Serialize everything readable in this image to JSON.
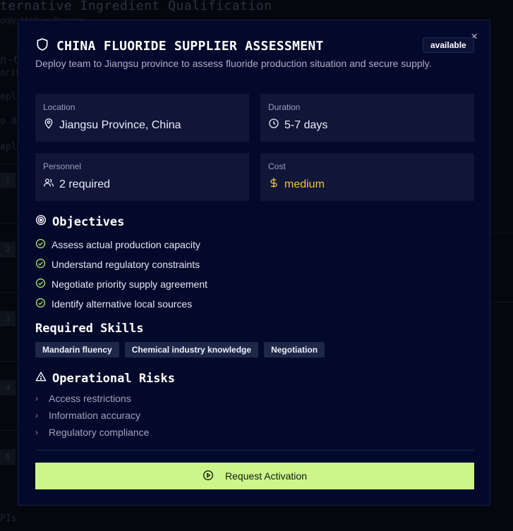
{
  "background": {
    "title": "ternative Ingredient Qualification",
    "subtitle": "ority: Medium Duration",
    "fragments": [
      "n-C",
      "orit",
      "eplo",
      "o 80",
      "aple",
      "PIs"
    ],
    "step_numbers": [
      "1",
      "2",
      "3",
      "4",
      "5"
    ]
  },
  "modal": {
    "title": "CHINA FLUORIDE SUPPLIER ASSESSMENT",
    "status_badge": "available",
    "close_label": "×",
    "description": "Deploy team to Jiangsu province to assess fluoride production situation and secure supply.",
    "details": {
      "location": {
        "label": "Location",
        "value": "Jiangsu Province, China",
        "icon": "map-pin-icon"
      },
      "duration": {
        "label": "Duration",
        "value": "5-7 days",
        "icon": "clock-icon"
      },
      "personnel": {
        "label": "Personnel",
        "value": "2 required",
        "icon": "users-icon"
      },
      "cost": {
        "label": "Cost",
        "value": "medium",
        "icon": "dollar-icon"
      }
    },
    "objectives": {
      "heading": "Objectives",
      "items": [
        "Assess actual production capacity",
        "Understand regulatory constraints",
        "Negotiate priority supply agreement",
        "Identify alternative local sources"
      ]
    },
    "skills": {
      "heading": "Required Skills",
      "items": [
        "Mandarin fluency",
        "Chemical industry knowledge",
        "Negotiation"
      ]
    },
    "risks": {
      "heading": "Operational Risks",
      "items": [
        "Access restrictions",
        "Information accuracy",
        "Regulatory compliance"
      ]
    },
    "action_label": "Request Activation"
  },
  "colors": {
    "modal_bg": "#03092b",
    "card_bg": "#0f1638",
    "accent": "#ccf58a",
    "check": "#a8e063",
    "cost": "#f4c430"
  }
}
